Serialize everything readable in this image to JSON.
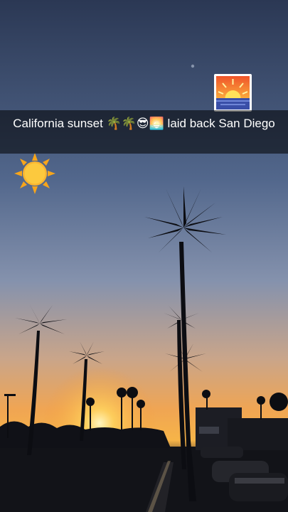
{
  "snap": {
    "caption_text": "California sunset 🌴🌴😎🌅 laid back San Diego",
    "caption_part1": "California sunset ",
    "caption_emojis": "🌴🌴😎🌅",
    "caption_part2": " laid back San Diego",
    "stickers": [
      {
        "name": "sunset-emoji-sticker",
        "icon": "sunrise-emoji"
      },
      {
        "name": "sun-emoji-sticker",
        "icon": "sun-emoji"
      }
    ],
    "colors": {
      "sky_top": "#2c3a5a",
      "sky_mid": "#6b7fa2",
      "horizon": "#f6a94a",
      "sun": "#ffd45e",
      "silhouette": "#0c0d12",
      "caption_bg": "rgba(0,0,0,0.55)"
    }
  }
}
